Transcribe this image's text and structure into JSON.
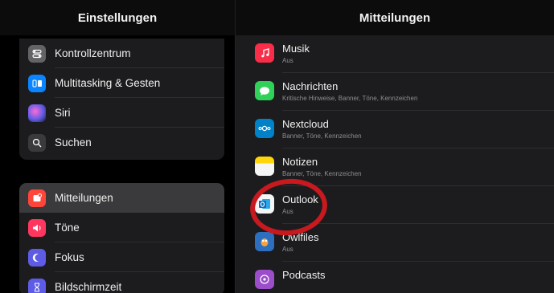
{
  "left": {
    "title": "Einstellungen",
    "group1": [
      {
        "label": "Kontrollzentrum",
        "icon": "toggles-icon",
        "color": "#636366"
      },
      {
        "label": "Multitasking & Gesten",
        "icon": "multitasking-icon",
        "color": "#0a84ff"
      },
      {
        "label": "Siri",
        "icon": "siri-icon",
        "color": "#5e5ce6"
      },
      {
        "label": "Suchen",
        "icon": "search-icon",
        "color": "#3a3a3c"
      }
    ],
    "group2": [
      {
        "label": "Mitteilungen",
        "icon": "notifications-icon",
        "color": "#ff453a",
        "selected": true
      },
      {
        "label": "Töne",
        "icon": "speaker-icon",
        "color": "#ff375f"
      },
      {
        "label": "Fokus",
        "icon": "moon-icon",
        "color": "#5e5ce6"
      },
      {
        "label": "Bildschirmzeit",
        "icon": "hourglass-icon",
        "color": "#5e5ce6"
      }
    ]
  },
  "right": {
    "title": "Mitteilungen",
    "apps": [
      {
        "name": "Musik",
        "sub": "Aus",
        "icon": "music-icon",
        "color": "#fa2d48"
      },
      {
        "name": "Nachrichten",
        "sub": "Kritische Hinweise, Banner, Töne, Kennzeichen",
        "icon": "messages-icon",
        "color": "#30d158"
      },
      {
        "name": "Nextcloud",
        "sub": "Banner, Töne, Kennzeichen",
        "icon": "nextcloud-icon",
        "color": "#0082c9"
      },
      {
        "name": "Notizen",
        "sub": "Banner, Töne, Kennzeichen",
        "icon": "notes-icon",
        "color": "#ffd60a"
      },
      {
        "name": "Outlook",
        "sub": "Aus",
        "icon": "outlook-icon",
        "color": "#0f6cbd"
      },
      {
        "name": "Owlfiles",
        "sub": "Aus",
        "icon": "owl-icon",
        "color": "#2c6fbf"
      },
      {
        "name": "Podcasts",
        "sub": "",
        "icon": "podcasts-icon",
        "color": "#9b4dca"
      }
    ]
  },
  "highlight_color": "#c8191f"
}
